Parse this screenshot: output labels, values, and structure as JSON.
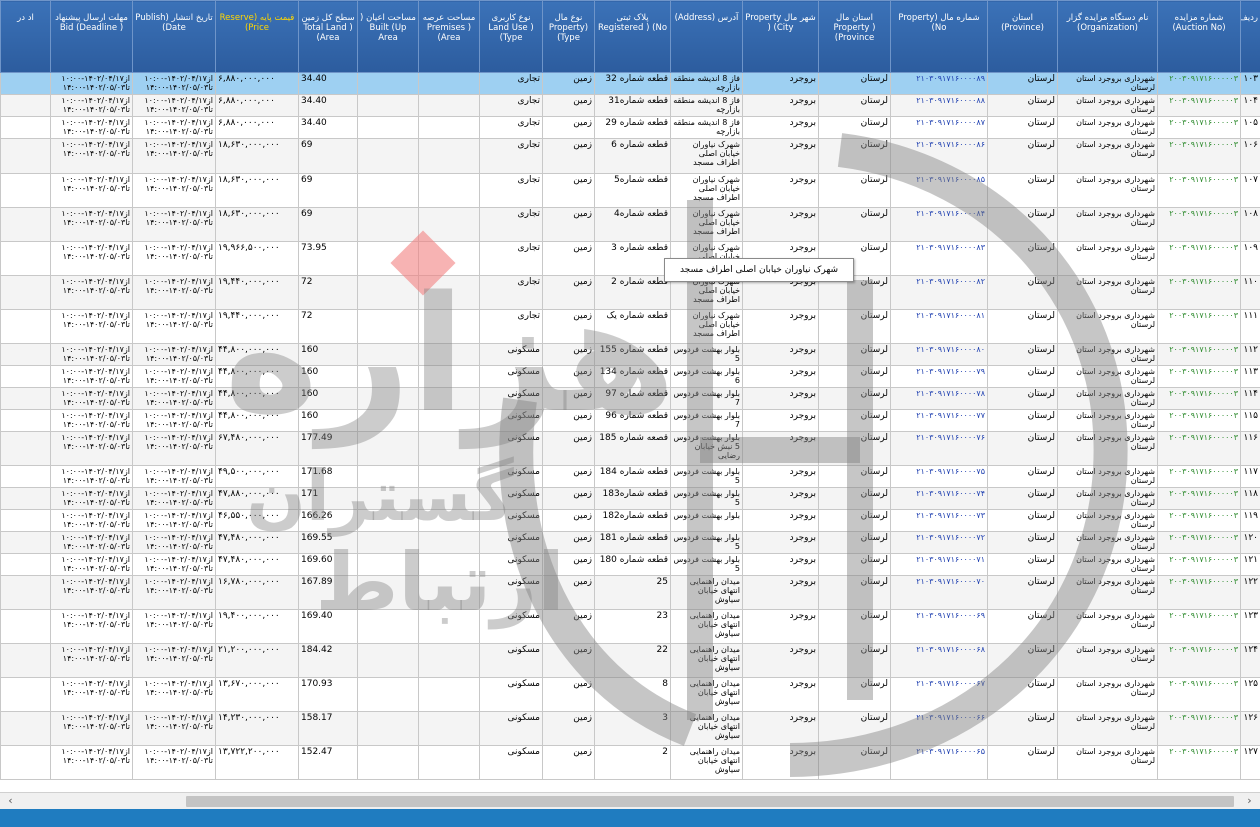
{
  "headers": [
    {
      "key": "row",
      "label": "ردیف"
    },
    {
      "key": "auction_no",
      "label": "شماره مزایده (Auction No)"
    },
    {
      "key": "organization",
      "label": "نام دستگاه مزایده گزار (Organization)"
    },
    {
      "key": "province",
      "label": "استان (Province)"
    },
    {
      "key": "property_no",
      "label": "شماره مال (Property No)"
    },
    {
      "key": "property_province",
      "label": "استان مال Property ) (Province"
    },
    {
      "key": "property_city",
      "label": "شهر مال Property ) (City"
    },
    {
      "key": "address",
      "label": "آدرس (Address)"
    },
    {
      "key": "registered_no",
      "label": "پلاک ثبتی Registered ) (No"
    },
    {
      "key": "property_type",
      "label": "نوع مال Property) (Type"
    },
    {
      "key": "land_use",
      "label": "نوع کاربری Land Use ) (Type"
    },
    {
      "key": "premises_area",
      "label": "مساحت عرصه Premises ) (Area"
    },
    {
      "key": "built_up_area",
      "label": "مساحت اعیان ( Built (Up Area"
    },
    {
      "key": "total_land_area",
      "label": "سطح کل زمین ( Total Land (Area"
    },
    {
      "key": "reserve_price",
      "label": "قیمت پایه (Reserve Price)"
    },
    {
      "key": "publish_date",
      "label": "تاریخ انتشار (Publish Date)"
    },
    {
      "key": "deadline",
      "label": "مهلت ارسال پیشنهاد ( Bid (Deadline"
    },
    {
      "key": "extra",
      "label": "اد در"
    }
  ],
  "common": {
    "auction_no": "۲۰۰۳۰۹۱۷۱۶۰۰۰۰۰۳",
    "organization": "شهرداری بروجرد استان لرستان",
    "province": "لرستان",
    "property_province": "لرستان",
    "property_city": "بروجرد",
    "property_type": "زمین",
    "publish_date": "از۱۴۰۲/۰۴/۱۷-۱۰:۰۰ تا۱۴۰۲/۰۵/۰۳-۱۴:۰۰",
    "deadline": "از۱۴۰۲/۰۴/۱۷-۱۰:۰۰ تا۱۴۰۲/۰۵/۰۳-۱۴:۰۰"
  },
  "rows": [
    {
      "row": "۱۰۳",
      "property_no": "۲۱۰۳۰۹۱۷۱۶۰۰۰۰۸۹",
      "address": "فاز 8 اندیشه منطقه بازارچه",
      "registered_no": "قطعه شماره 32",
      "land_use": "تجاری",
      "total_land_area": "34.40",
      "reserve_price": "۶,۸۸۰,۰۰۰,۰۰۰",
      "selected": true
    },
    {
      "row": "۱۰۴",
      "property_no": "۲۱۰۳۰۹۱۷۱۶۰۰۰۰۸۸",
      "address": "فاز 8 اندیشه منطقه بازارچه",
      "registered_no": "قطعه شماره31",
      "land_use": "تجاری",
      "total_land_area": "34.40",
      "reserve_price": "۶,۸۸۰,۰۰۰,۰۰۰"
    },
    {
      "row": "۱۰۵",
      "property_no": "۲۱۰۳۰۹۱۷۱۶۰۰۰۰۸۷",
      "address": "فاز 8 اندیشه منطقه بازارچه",
      "registered_no": "قطعه شماره 29",
      "land_use": "تجاری",
      "total_land_area": "34.40",
      "reserve_price": "۶,۸۸۰,۰۰۰,۰۰۰"
    },
    {
      "row": "۱۰۶",
      "property_no": "۲۱۰۳۰۹۱۷۱۶۰۰۰۰۸۶",
      "address": "شهرک نیاوران خیابان اصلی اطراف مسجد",
      "registered_no": "قطعه شماره 6",
      "land_use": "تجاری",
      "total_land_area": "69",
      "reserve_price": "۱۸,۶۳۰,۰۰۰,۰۰۰"
    },
    {
      "row": "۱۰۷",
      "property_no": "۲۱۰۳۰۹۱۷۱۶۰۰۰۰۸۵",
      "address": "شهرک نیاوران خیابان اصلی اطراف مسجد",
      "registered_no": "قطعه شماره5",
      "land_use": "تجاری",
      "total_land_area": "69",
      "reserve_price": "۱۸,۶۳۰,۰۰۰,۰۰۰"
    },
    {
      "row": "۱۰۸",
      "property_no": "۲۱۰۳۰۹۱۷۱۶۰۰۰۰۸۴",
      "address": "شهرک نیاوران خیابان اصلی اطراف مسجد",
      "registered_no": "قطعه شماره4",
      "land_use": "تجاری",
      "total_land_area": "69",
      "reserve_price": "۱۸,۶۳۰,۰۰۰,۰۰۰"
    },
    {
      "row": "۱۰۹",
      "property_no": "۲۱۰۳۰۹۱۷۱۶۰۰۰۰۸۳",
      "address": "شهرک نیاوران خیابان اصلی اطراف مسجد",
      "registered_no": "قطعه شماره 3",
      "land_use": "تجاری",
      "total_land_area": "73.95",
      "reserve_price": "۱۹,۹۶۶,۵۰۰,۰۰۰"
    },
    {
      "row": "۱۱۰",
      "property_no": "۲۱۰۳۰۹۱۷۱۶۰۰۰۰۸۲",
      "address": "شهرک نیاوران خیابان اصلی اطراف مسجد",
      "registered_no": "قطعه شماره 2",
      "land_use": "تجاری",
      "total_land_area": "72",
      "reserve_price": "۱۹,۴۴۰,۰۰۰,۰۰۰"
    },
    {
      "row": "۱۱۱",
      "property_no": "۲۱۰۳۰۹۱۷۱۶۰۰۰۰۸۱",
      "address": "شهرک نیاوران خیابان اصلی اطراف مسجد",
      "registered_no": "قطعه شماره یک",
      "land_use": "تجاری",
      "total_land_area": "72",
      "reserve_price": "۱۹,۴۴۰,۰۰۰,۰۰۰"
    },
    {
      "row": "۱۱۲",
      "property_no": "۲۱۰۳۰۹۱۷۱۶۰۰۰۰۸۰",
      "address": "بلوار بهشت فردوس 5",
      "registered_no": "قطعه شماره 155",
      "land_use": "مسکونی",
      "total_land_area": "160",
      "reserve_price": "۴۴,۸۰۰,۰۰۰,۰۰۰"
    },
    {
      "row": "۱۱۳",
      "property_no": "۲۱۰۳۰۹۱۷۱۶۰۰۰۰۷۹",
      "address": "بلوار بهشت فردوس 6",
      "registered_no": "قطعه شماره 134",
      "land_use": "مسکونی",
      "total_land_area": "160",
      "reserve_price": "۴۴,۸۰۰,۰۰۰,۰۰۰"
    },
    {
      "row": "۱۱۴",
      "property_no": "۲۱۰۳۰۹۱۷۱۶۰۰۰۰۷۸",
      "address": "بلوار بهشت فردوس 7",
      "registered_no": "قطعه شماره 97",
      "land_use": "مسکونی",
      "total_land_area": "160",
      "reserve_price": "۴۴,۸۰۰,۰۰۰,۰۰۰"
    },
    {
      "row": "۱۱۵",
      "property_no": "۲۱۰۳۰۹۱۷۱۶۰۰۰۰۷۷",
      "address": "بلوار بهشت فردوس 7",
      "registered_no": "قطعه شماره 96",
      "land_use": "مسکونی",
      "total_land_area": "160",
      "reserve_price": "۴۴,۸۰۰,۰۰۰,۰۰۰"
    },
    {
      "row": "۱۱۶",
      "property_no": "۲۱۰۳۰۹۱۷۱۶۰۰۰۰۷۶",
      "address": "بلوار بهشت فردوس 5 نبش خیابان رضایی",
      "registered_no": "قصعه شماره 185",
      "land_use": "مسکونی",
      "total_land_area": "177.49",
      "reserve_price": "۶۷,۴۸۰,۰۰۰,۰۰۰"
    },
    {
      "row": "۱۱۷",
      "property_no": "۲۱۰۳۰۹۱۷۱۶۰۰۰۰۷۵",
      "address": "بلوار بهشت فردوس 5",
      "registered_no": "قطعه شماره 184",
      "land_use": "مسکونی",
      "total_land_area": "171.68",
      "reserve_price": "۴۹,۵۰۰,۰۰۰,۰۰۰"
    },
    {
      "row": "۱۱۸",
      "property_no": "۲۱۰۳۰۹۱۷۱۶۰۰۰۰۷۴",
      "address": "بلوار بهشت فردوس 5",
      "registered_no": "قطعه شماره183",
      "land_use": "مسکونی",
      "total_land_area": "171",
      "reserve_price": "۴۷,۸۸۰,۰۰۰,۰۰۰"
    },
    {
      "row": "۱۱۹",
      "property_no": "۲۱۰۳۰۹۱۷۱۶۰۰۰۰۷۳",
      "address": "بلوار بهشت فردوس",
      "registered_no": "قطعه شماره182",
      "land_use": "مسکونی",
      "total_land_area": "166.26",
      "reserve_price": "۴۶,۵۵۰,۰۰۰,۰۰۰"
    },
    {
      "row": "۱۲۰",
      "property_no": "۲۱۰۳۰۹۱۷۱۶۰۰۰۰۷۲",
      "address": "بلوار بهشت فردوس 5",
      "registered_no": "قطعه شماره 181",
      "land_use": "مسکونی",
      "total_land_area": "169.55",
      "reserve_price": "۴۷,۴۸۰,۰۰۰,۰۰۰"
    },
    {
      "row": "۱۲۱",
      "property_no": "۲۱۰۳۰۹۱۷۱۶۰۰۰۰۷۱",
      "address": "بلوار بهشت فردوس 5",
      "registered_no": "قطعه شماره 180",
      "land_use": "مسکونی",
      "total_land_area": "169.60",
      "reserve_price": "۴۷,۴۸۰,۰۰۰,۰۰۰"
    },
    {
      "row": "۱۲۲",
      "property_no": "۲۱۰۳۰۹۱۷۱۶۰۰۰۰۷۰",
      "address": "میدان راهنمایی انتهای خیابان سیاوش",
      "registered_no": "25",
      "land_use": "مسکونی",
      "total_land_area": "167.89",
      "reserve_price": "۱۶,۷۸۰,۰۰۰,۰۰۰"
    },
    {
      "row": "۱۲۳",
      "property_no": "۲۱۰۳۰۹۱۷۱۶۰۰۰۰۶۹",
      "address": "میدان راهنمایی انتهای خیابان سیاوش",
      "registered_no": "23",
      "land_use": "مسکونی",
      "total_land_area": "169.40",
      "reserve_price": "۱۹,۴۰۰,۰۰۰,۰۰۰"
    },
    {
      "row": "۱۲۴",
      "property_no": "۲۱۰۳۰۹۱۷۱۶۰۰۰۰۶۸",
      "address": "میدان راهنمایی انتهای خیابان سیاوش",
      "registered_no": "22",
      "land_use": "مسکونی",
      "total_land_area": "184.42",
      "reserve_price": "۲۱,۲۰۰,۰۰۰,۰۰۰"
    },
    {
      "row": "۱۲۵",
      "property_no": "۲۱۰۳۰۹۱۷۱۶۰۰۰۰۶۷",
      "address": "میدان راهنمایی انتهای خیابان سیاوش",
      "registered_no": "8",
      "land_use": "مسکونی",
      "total_land_area": "170.93",
      "reserve_price": "۱۳,۶۷۰,۰۰۰,۰۰۰"
    },
    {
      "row": "۱۲۶",
      "property_no": "۲۱۰۳۰۹۱۷۱۶۰۰۰۰۶۶",
      "address": "میدان راهنمایی انتهای خیابان سیاوش",
      "registered_no": "3",
      "land_use": "مسکونی",
      "total_land_area": "158.17",
      "reserve_price": "۱۴,۲۳۰,۰۰۰,۰۰۰"
    },
    {
      "row": "۱۲۷",
      "property_no": "۲۱۰۳۰۹۱۷۱۶۰۰۰۰۶۵",
      "address": "میدان راهنمایی انتهای خیابان سیاوش",
      "registered_no": "2",
      "land_use": "مسکونی",
      "total_land_area": "152.47",
      "reserve_price": "۱۳,۷۲۲,۲۰۰,۰۰۰"
    }
  ],
  "tooltip": "شهرک نیاوران خیابان اصلی اطراف مسجد",
  "watermark_text": [
    "هزاره",
    "گستران",
    "ارتباط"
  ],
  "scroll": {
    "left_arrow": "‹",
    "right_arrow": "›"
  },
  "colors": {
    "header_bg": "#2f62a8",
    "reserve_header": "#ffd700",
    "auction_no": "#2e8b2e",
    "property_no": "#1e3fb0",
    "selected_row": "#9ed0f2",
    "footer": "#1f7cc0"
  }
}
